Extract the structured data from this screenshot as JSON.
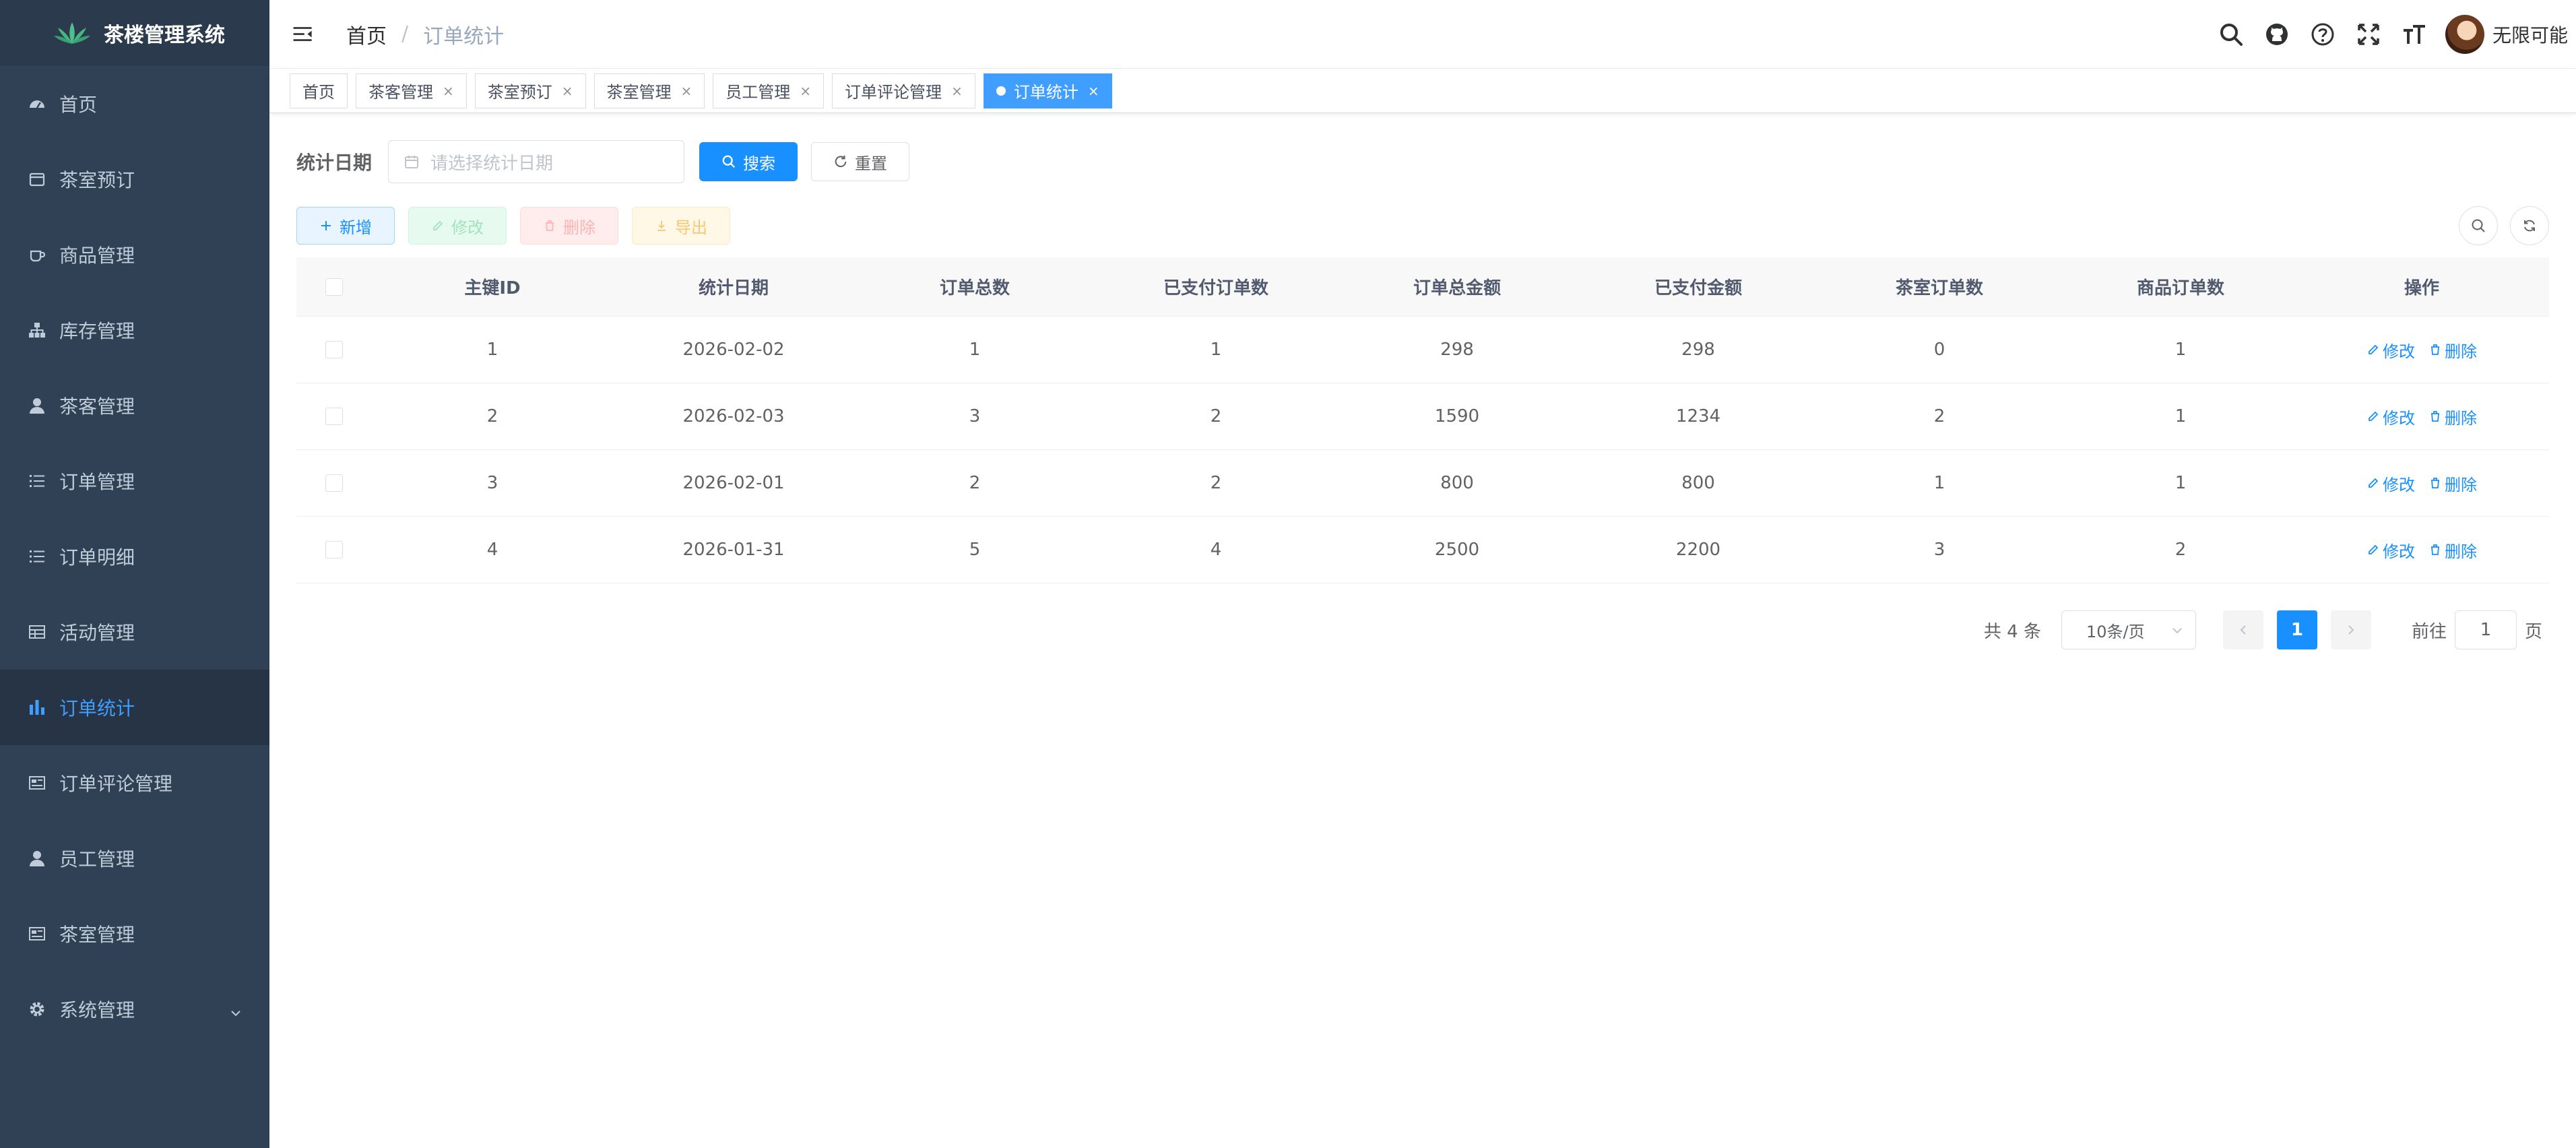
{
  "app": {
    "title": "茶楼管理系统"
  },
  "sidebar": {
    "items": [
      {
        "label": "首页",
        "icon": "dashboard-icon",
        "active": false
      },
      {
        "label": "茶室预订",
        "icon": "calendar-icon",
        "active": false
      },
      {
        "label": "商品管理",
        "icon": "cup-icon",
        "active": false
      },
      {
        "label": "库存管理",
        "icon": "tree-icon",
        "active": false
      },
      {
        "label": "茶客管理",
        "icon": "user-icon",
        "active": false
      },
      {
        "label": "订单管理",
        "icon": "list-icon",
        "active": false
      },
      {
        "label": "订单明细",
        "icon": "list-icon",
        "active": false
      },
      {
        "label": "活动管理",
        "icon": "table-icon",
        "active": false
      },
      {
        "label": "订单统计",
        "icon": "chart-icon",
        "active": true
      },
      {
        "label": "订单评论管理",
        "icon": "card-icon",
        "active": false
      },
      {
        "label": "员工管理",
        "icon": "user-icon",
        "active": false
      },
      {
        "label": "茶室管理",
        "icon": "card-icon",
        "active": false
      },
      {
        "label": "系统管理",
        "icon": "gear-icon",
        "active": false
      }
    ]
  },
  "header": {
    "breadcrumb": {
      "home": "首页",
      "separator": "/",
      "current": "订单统计"
    },
    "username": "无限可能"
  },
  "tags": [
    {
      "label": "首页",
      "closable": false,
      "active": false
    },
    {
      "label": "茶客管理",
      "closable": true,
      "active": false
    },
    {
      "label": "茶室预订",
      "closable": true,
      "active": false
    },
    {
      "label": "茶室管理",
      "closable": true,
      "active": false
    },
    {
      "label": "员工管理",
      "closable": true,
      "active": false
    },
    {
      "label": "订单评论管理",
      "closable": true,
      "active": false
    },
    {
      "label": "订单统计",
      "closable": true,
      "active": true
    }
  ],
  "tag_close_glyph": "×",
  "search": {
    "label": "统计日期",
    "placeholder": "请选择统计日期",
    "search_label": "搜索",
    "reset_label": "重置"
  },
  "toolbar": {
    "add_label": "新增",
    "edit_label": "修改",
    "delete_label": "删除",
    "export_label": "导出"
  },
  "table": {
    "columns": [
      "主键ID",
      "统计日期",
      "订单总数",
      "已支付订单数",
      "订单总金额",
      "已支付金额",
      "茶室订单数",
      "商品订单数",
      "操作"
    ],
    "rows": [
      [
        "1",
        "2026-02-02",
        "1",
        "1",
        "298",
        "298",
        "0",
        "1"
      ],
      [
        "2",
        "2026-02-03",
        "3",
        "2",
        "1590",
        "1234",
        "2",
        "1"
      ],
      [
        "3",
        "2026-02-01",
        "2",
        "2",
        "800",
        "800",
        "1",
        "1"
      ],
      [
        "4",
        "2026-01-31",
        "5",
        "4",
        "2500",
        "2200",
        "3",
        "2"
      ]
    ],
    "row_edit_label": "修改",
    "row_delete_label": "删除"
  },
  "pagination": {
    "total_text": "共 4 条",
    "page_size": "10条/页",
    "current_page": "1",
    "goto_label": "前往",
    "goto_value": "1",
    "page_suffix": "页"
  },
  "colors": {
    "sidebar_bg": "#304156",
    "accent": "#1890ff",
    "active_menu_text": "#409eff"
  }
}
